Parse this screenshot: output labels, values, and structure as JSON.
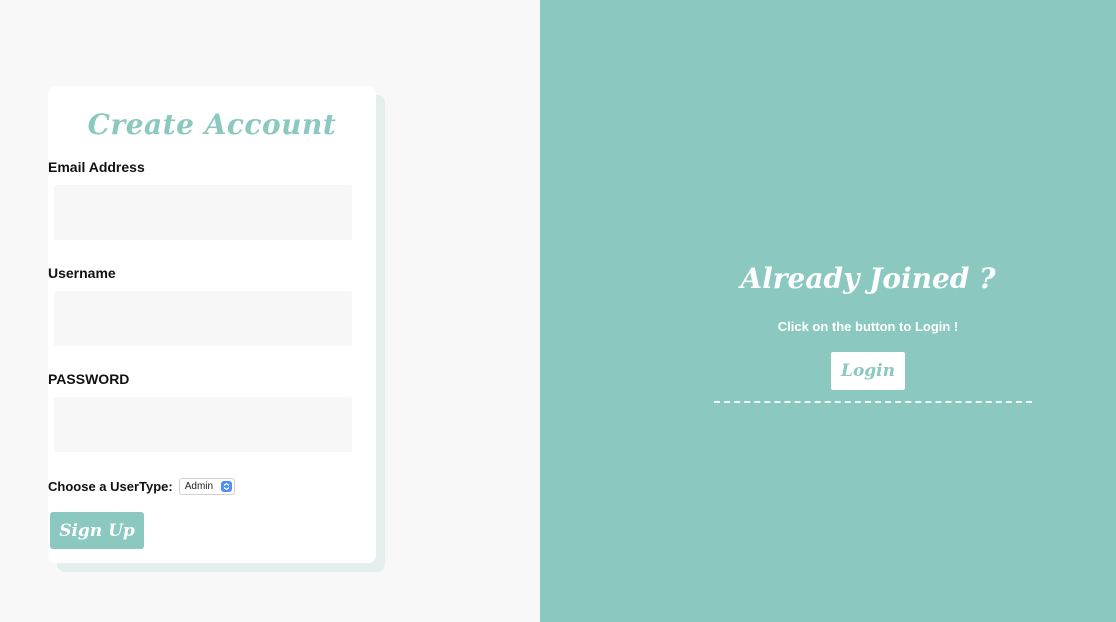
{
  "signup": {
    "title": "Create Account",
    "email_label": "Email Address",
    "email_value": "",
    "username_label": "Username",
    "username_value": "",
    "password_label": "PASSWORD",
    "password_value": "",
    "usertype_label": "Choose a UserType:",
    "usertype_selected": "Admin",
    "signup_label": "Sign Up"
  },
  "login_panel": {
    "title": "Already Joined ?",
    "subtitle": "Click on the button to Login !",
    "login_label": "Login"
  },
  "colors": {
    "accent": "#8ac8c0",
    "left_background": "#f8f8f8",
    "card_background": "#ffffff",
    "input_background": "#f7f7f7",
    "select_arrow": "#4f8ef7"
  },
  "icons": {
    "select_arrows": "up-down-chevron-icon"
  }
}
